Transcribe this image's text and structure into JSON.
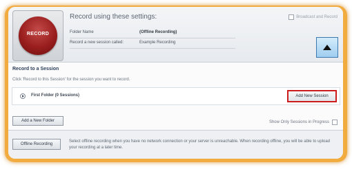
{
  "record": {
    "label": "RECORD"
  },
  "settings": {
    "title": "Record using these settings:",
    "broadcast_label": "Broadcast and Record",
    "folder_label": "Folder Name",
    "folder_value": "(Offline Recording)",
    "session_label": "Record a new session called:",
    "session_value": "Example Recording"
  },
  "session_panel": {
    "title": "Record to a Session",
    "hint": "Click 'Record to this Session' for the session you want to record.",
    "folder_name": "First Folder (0 Sessions)",
    "add_session_label": "Add New Session",
    "add_folder_label": "Add a New Folder",
    "show_progress_label": "Show Only Sessions in Progress"
  },
  "offline": {
    "button_label": "Offline Recording",
    "description": "Select offline recording when you have no network connection or your server is unreachable. When recording offline, you will be able to upload your recording at a later time."
  },
  "colors": {
    "frame": "#f1ab3e",
    "record_red": "#9a1e1e",
    "highlight_red": "#cc1b1b",
    "collapse_blue": "#9fcdf0"
  }
}
